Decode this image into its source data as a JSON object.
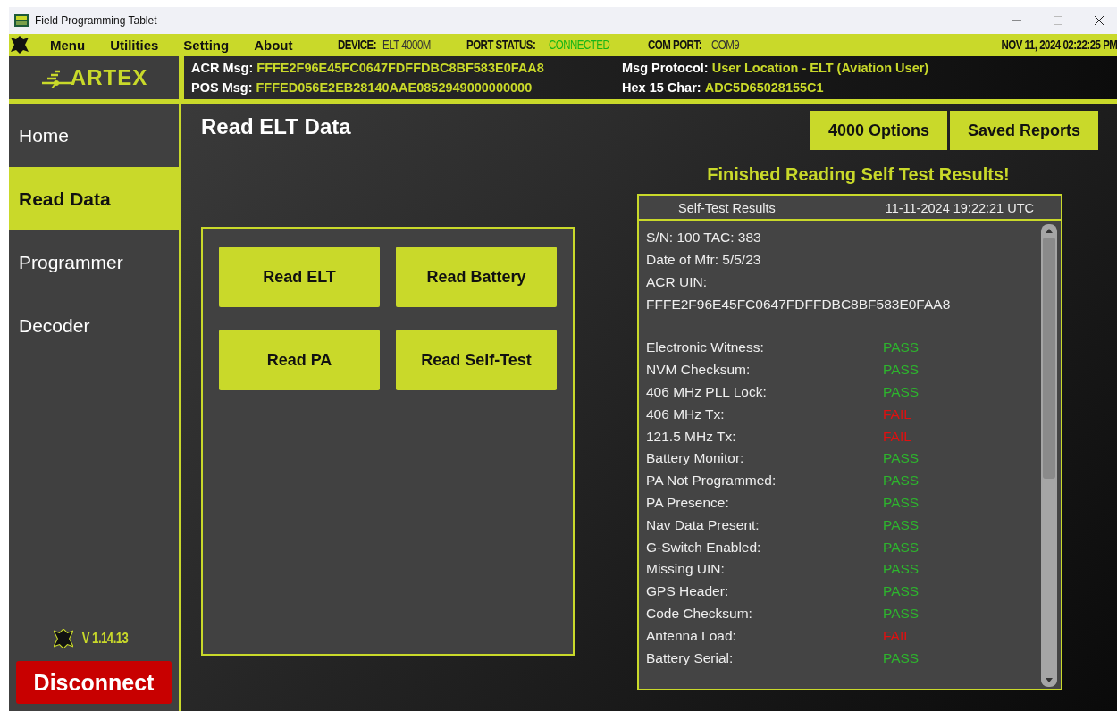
{
  "window": {
    "title": "Field Programming Tablet"
  },
  "menu": [
    "Menu",
    "Utilities",
    "Setting",
    "About"
  ],
  "status": {
    "device_label": "DEVICE:",
    "device": "ELT 4000M",
    "port_label": "PORT STATUS:",
    "port_status": "CONNECTED",
    "connected": true,
    "com_label": "COM PORT:",
    "com": "COM9",
    "datetime": "NOV 11, 2024  02:22:25 PM"
  },
  "logo": "ARTEX",
  "messages": [
    {
      "label": "ACR Msg:",
      "value": "FFFE2F96E45FC0647FDFFDBC8BF583E0FAA8"
    },
    {
      "label": "POS Msg:",
      "value": "FFFED056E2EB28140AAE0852949000000000"
    },
    {
      "label": "Msg Protocol:",
      "value": "User Location - ELT (Aviation User)"
    },
    {
      "label": "Hex 15 Char:",
      "value": "ADC5D65028155C1"
    }
  ],
  "sidebar": {
    "items": [
      {
        "label": "Home",
        "selected": false
      },
      {
        "label": "Read Data",
        "selected": true
      },
      {
        "label": "Programmer",
        "selected": false
      },
      {
        "label": "Decoder",
        "selected": false
      }
    ],
    "version": "V 1.14.13",
    "disconnect": "Disconnect"
  },
  "page": {
    "title": "Read ELT Data",
    "buttons": [
      "4000 Options",
      "Saved Reports"
    ],
    "actions": [
      "Read ELT",
      "Read Battery",
      "Read PA",
      "Read Self-Test"
    ],
    "message": "Finished Reading Self Test Results!"
  },
  "results": {
    "title": "Self-Test Results",
    "timestamp": "11-11-2024 19:22:21 UTC",
    "info": [
      "S/N: 100 TAC: 383",
      "Date of Mfr: 5/5/23",
      "ACR UIN:",
      "FFFE2F96E45FC0647FDFFDBC8BF583E0FAA8"
    ],
    "tests": [
      {
        "name": "Electronic Witness:",
        "result": "PASS",
        "passed": true
      },
      {
        "name": "NVM Checksum:",
        "result": "PASS",
        "passed": true
      },
      {
        "name": "406 MHz PLL Lock:",
        "result": "PASS",
        "passed": true
      },
      {
        "name": "406 MHz Tx:",
        "result": "FAIL",
        "passed": false
      },
      {
        "name": "121.5 MHz Tx:",
        "result": "FAIL",
        "passed": false
      },
      {
        "name": "Battery Monitor:",
        "result": "PASS",
        "passed": true
      },
      {
        "name": "PA Not Programmed:",
        "result": "PASS",
        "passed": true
      },
      {
        "name": "PA Presence:",
        "result": "PASS",
        "passed": true
      },
      {
        "name": "Nav Data Present:",
        "result": "PASS",
        "passed": true
      },
      {
        "name": "G-Switch Enabled:",
        "result": "PASS",
        "passed": true
      },
      {
        "name": "Missing UIN:",
        "result": "PASS",
        "passed": true
      },
      {
        "name": "GPS Header:",
        "result": "PASS",
        "passed": true
      },
      {
        "name": "Code Checksum:",
        "result": "PASS",
        "passed": true
      },
      {
        "name": "Antenna Load:",
        "result": "FAIL",
        "passed": false
      },
      {
        "name": "Battery Serial:",
        "result": "PASS",
        "passed": true
      }
    ]
  }
}
